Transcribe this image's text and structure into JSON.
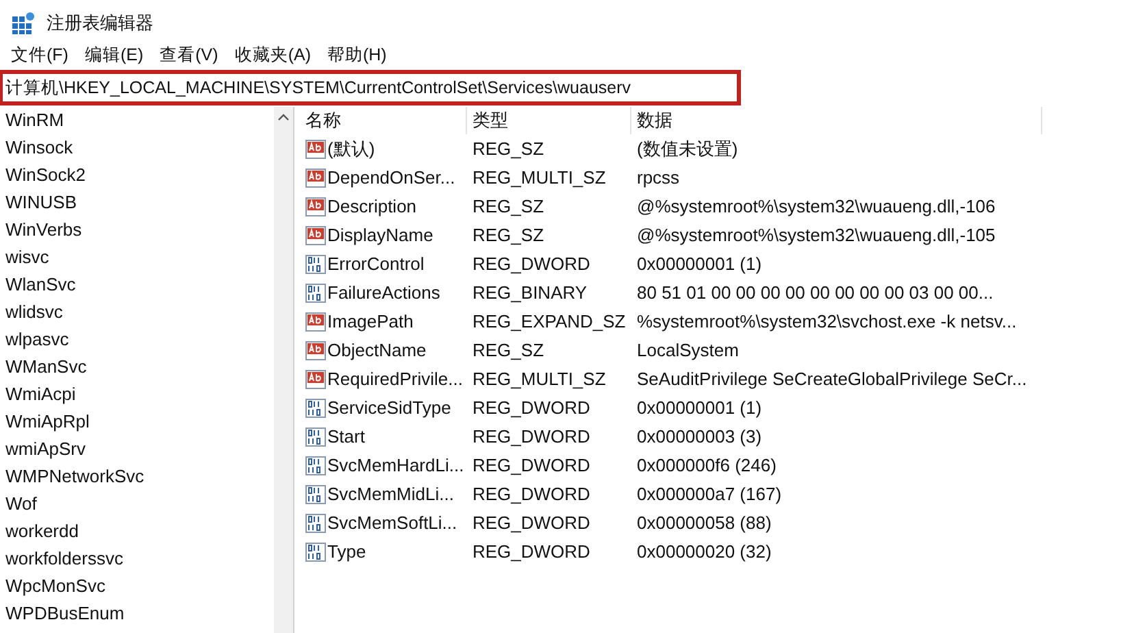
{
  "window": {
    "title": "注册表编辑器"
  },
  "menu": [
    "文件(F)",
    "编辑(E)",
    "查看(V)",
    "收藏夹(A)",
    "帮助(H)"
  ],
  "address": "计算机\\HKEY_LOCAL_MACHINE\\SYSTEM\\CurrentControlSet\\Services\\wuauserv",
  "tree": {
    "items": [
      {
        "label": "WinRM",
        "selected": false
      },
      {
        "label": "Winsock",
        "selected": false
      },
      {
        "label": "WinSock2",
        "selected": false
      },
      {
        "label": "WINUSB",
        "selected": false
      },
      {
        "label": "WinVerbs",
        "selected": false
      },
      {
        "label": "wisvc",
        "selected": false
      },
      {
        "label": "WlanSvc",
        "selected": false
      },
      {
        "label": "wlidsvc",
        "selected": false
      },
      {
        "label": "wlpasvc",
        "selected": false
      },
      {
        "label": "WManSvc",
        "selected": false
      },
      {
        "label": "WmiAcpi",
        "selected": false
      },
      {
        "label": "WmiApRpl",
        "selected": false
      },
      {
        "label": "wmiApSrv",
        "selected": false
      },
      {
        "label": "WMPNetworkSvc",
        "selected": false
      },
      {
        "label": "Wof",
        "selected": false
      },
      {
        "label": "workerdd",
        "selected": false
      },
      {
        "label": "workfolderssvc",
        "selected": false
      },
      {
        "label": "WpcMonSvc",
        "selected": false
      },
      {
        "label": "WPDBusEnum",
        "selected": false
      }
    ]
  },
  "table": {
    "columns": [
      "名称",
      "类型",
      "数据"
    ],
    "rows": [
      {
        "kind": "string",
        "name": "(默认)",
        "type": "REG_SZ",
        "data": "(数值未设置)"
      },
      {
        "kind": "string",
        "name": "DependOnSer...",
        "type": "REG_MULTI_SZ",
        "data": "rpcss"
      },
      {
        "kind": "string",
        "name": "Description",
        "type": "REG_SZ",
        "data": "@%systemroot%\\system32\\wuaueng.dll,-106"
      },
      {
        "kind": "string",
        "name": "DisplayName",
        "type": "REG_SZ",
        "data": "@%systemroot%\\system32\\wuaueng.dll,-105"
      },
      {
        "kind": "binary",
        "name": "ErrorControl",
        "type": "REG_DWORD",
        "data": "0x00000001 (1)"
      },
      {
        "kind": "binary",
        "name": "FailureActions",
        "type": "REG_BINARY",
        "data": "80 51 01 00 00 00 00 00 00 00 00 03 00 00..."
      },
      {
        "kind": "string",
        "name": "ImagePath",
        "type": "REG_EXPAND_SZ",
        "data": "%systemroot%\\system32\\svchost.exe -k netsv..."
      },
      {
        "kind": "string",
        "name": "ObjectName",
        "type": "REG_SZ",
        "data": "LocalSystem"
      },
      {
        "kind": "string",
        "name": "RequiredPrivile...",
        "type": "REG_MULTI_SZ",
        "data": "SeAuditPrivilege SeCreateGlobalPrivilege SeCr..."
      },
      {
        "kind": "binary",
        "name": "ServiceSidType",
        "type": "REG_DWORD",
        "data": "0x00000001 (1)"
      },
      {
        "kind": "binary",
        "name": "Start",
        "type": "REG_DWORD",
        "data": "0x00000003 (3)"
      },
      {
        "kind": "binary",
        "name": "SvcMemHardLi...",
        "type": "REG_DWORD",
        "data": "0x000000f6 (246)"
      },
      {
        "kind": "binary",
        "name": "SvcMemMidLi...",
        "type": "REG_DWORD",
        "data": "0x000000a7 (167)"
      },
      {
        "kind": "binary",
        "name": "SvcMemSoftLi...",
        "type": "REG_DWORD",
        "data": "0x00000058 (88)"
      },
      {
        "kind": "binary",
        "name": "Type",
        "type": "REG_DWORD",
        "data": "0x00000020 (32)"
      }
    ]
  }
}
